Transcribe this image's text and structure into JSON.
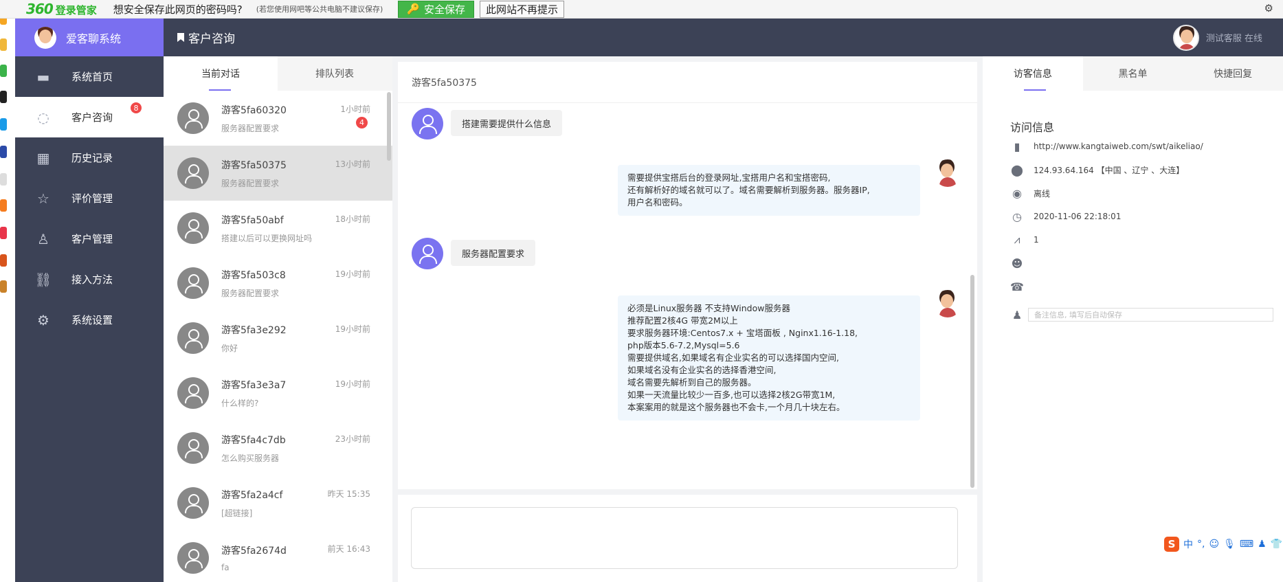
{
  "password_bar": {
    "brand_number": "360",
    "brand_name": "登录管家",
    "question": "想安全保存此网页的密码吗?",
    "note": "(若您使用网吧等公共电脑不建议保存)",
    "save_label": "安全保存",
    "never_label": "此网站不再提示"
  },
  "sidebar": {
    "brand": "爱客聊系统",
    "items": [
      {
        "label": "系统首页",
        "icon": "window-icon"
      },
      {
        "label": "客户咨询",
        "icon": "chat-bubble-icon",
        "badge": "8"
      },
      {
        "label": "历史记录",
        "icon": "calendar-icon"
      },
      {
        "label": "评价管理",
        "icon": "star-icon"
      },
      {
        "label": "客户管理",
        "icon": "user-icon"
      },
      {
        "label": "接入方法",
        "icon": "link-icon"
      },
      {
        "label": "系统设置",
        "icon": "gear-icon"
      }
    ]
  },
  "header": {
    "title": "客户咨询",
    "user_status": "测试客服 在线"
  },
  "conversations": {
    "tabs": [
      "当前对话",
      "排队列表"
    ],
    "items": [
      {
        "name": "游客5fa60320",
        "msg": "服务器配置要求",
        "time": "1小时前",
        "unread": "4"
      },
      {
        "name": "游客5fa50375",
        "msg": "服务器配置要求",
        "time": "13小时前"
      },
      {
        "name": "游客5fa50abf",
        "msg": "搭建以后可以更换网址吗",
        "time": "18小时前"
      },
      {
        "name": "游客5fa503c8",
        "msg": "服务器配置要求",
        "time": "19小时前"
      },
      {
        "name": "游客5fa3e292",
        "msg": "你好",
        "time": "19小时前"
      },
      {
        "name": "游客5fa3e3a7",
        "msg": "什么样的?",
        "time": "19小时前"
      },
      {
        "name": "游客5fa4c7db",
        "msg": "怎么购买服务器",
        "time": "23小时前"
      },
      {
        "name": "游客5fa2a4cf",
        "msg": "[超链接]",
        "time": "昨天 15:35"
      },
      {
        "name": "游客5fa2674d",
        "msg": "fa",
        "time": "前天 16:43"
      }
    ]
  },
  "chat": {
    "title": "游客5fa50375",
    "messages": [
      {
        "from": "visitor",
        "lines": [
          "搭建需要提供什么信息"
        ]
      },
      {
        "from": "agent",
        "lines": [
          "需要提供宝搭后台的登录网址,宝搭用户名和宝搭密码,",
          "还有解析好的域名就可以了。域名需要解析到服务器。服务器IP,",
          "用户名和密码。"
        ]
      },
      {
        "from": "visitor",
        "lines": [
          "服务器配置要求"
        ]
      },
      {
        "from": "agent",
        "lines": [
          "必须是Linux服务器 不支持Window服务器",
          "推荐配置2核4G 带宽2M以上",
          "要求服务器环境:Centos7.x + 宝塔面板 , Nginx1.16-1.18,",
          "php版本5.6-7.2,Mysql=5.6",
          "需要提供域名,如果域名有企业实名的可以选择国内空间,",
          "如果域名没有企业实名的选择香港空间,",
          "域名需要先解析到自己的服务器。",
          "如果一天流量比较少一百多,也可以选择2核2G带宽1M,",
          "本案案用的就是这个服务器也不会卡,一个月几十块左右。"
        ]
      }
    ]
  },
  "info": {
    "tabs": [
      "访客信息",
      "黑名单",
      "快捷回复"
    ],
    "heading": "访问信息",
    "url": "http://www.kangtaiweb.com/swt/aikeliao/",
    "ip": "124.93.64.164 【中国 、辽宁 、大连】",
    "status": "离线",
    "time": "2020-11-06 22:18:01",
    "visits": "1",
    "name": "",
    "phone": "",
    "note_placeholder": "备注信息, 填写后自动保存"
  },
  "ime": {
    "logo": "S",
    "lang": "中"
  }
}
